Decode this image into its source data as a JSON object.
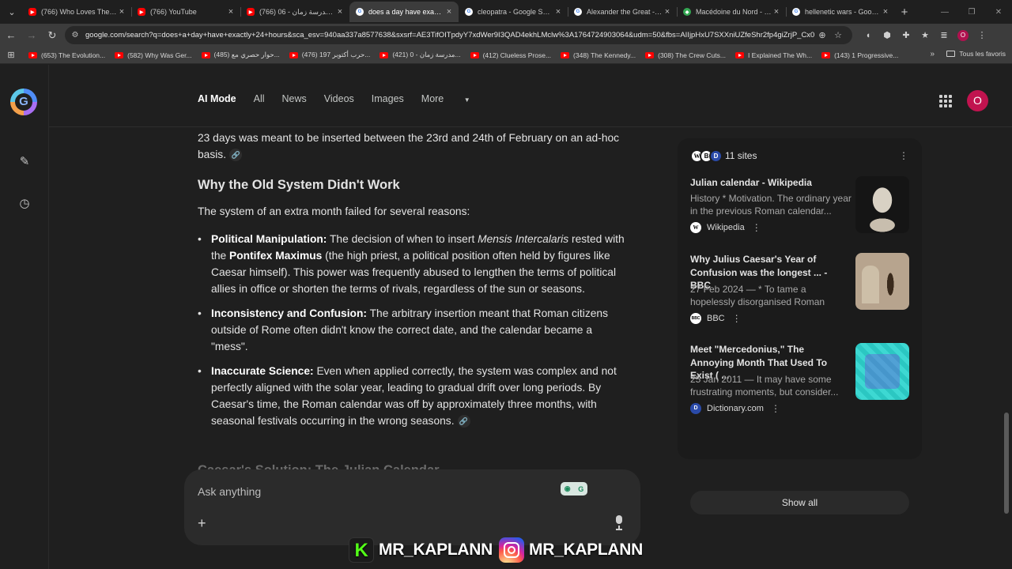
{
  "browser": {
    "tabs": [
      {
        "title": "(766) Who Loves The Sun",
        "favicon": "youtube-icon"
      },
      {
        "title": "(766) YouTube",
        "favicon": "youtube-icon"
      },
      {
        "title": "(766) مدرسة زمان - 06 (da",
        "favicon": "youtube-icon"
      },
      {
        "title": "does a day have exactly 2",
        "favicon": "google-icon",
        "active": true
      },
      {
        "title": "cleopatra - Google Search",
        "favicon": "google-icon"
      },
      {
        "title": "Alexander the Great - Go",
        "favicon": "google-icon"
      },
      {
        "title": "Macédoine du Nord - Go",
        "favicon": "maps-icon"
      },
      {
        "title": "hellenetic wars - Google S",
        "favicon": "google-icon"
      }
    ],
    "url": "google.com/search?q=does+a+day+have+exactly+24+hours&sca_esv=940aa337a8577638&sxsrf=AE3TifOITpdyY7xdWer9I3QAD4ekhLMclw%3A1764724903064&udm=50&fbs=AIIjpHxU7SXXniUZfeShr2fp4giZrjP_Cx0LI1Ytb...",
    "profile_letter": "O",
    "bookmarks": [
      "(653) The Evolution...",
      "(582) Why Was Ger...",
      "(485) حوار حصري مع...",
      "(476) حرب أكتوبر 197...",
      "(421) مدرسة زمان - 0...",
      "(412) Clueless Prose...",
      "(348) The Kennedy...",
      "(308) The Crew Cuts...",
      "I Explained The Wh...",
      "(143) 1 Progressive..."
    ],
    "bookmarks_folder": "Tous les favoris"
  },
  "nav": {
    "items": [
      "AI Mode",
      "All",
      "News",
      "Videos",
      "Images",
      "More"
    ],
    "avatar_letter": "O"
  },
  "article": {
    "intro": "23 days was meant to be inserted between the 23rd and 24th of February on an ad-hoc basis.",
    "heading": "Why the Old System Didn't Work",
    "lead": "The system of an extra month failed for several reasons:",
    "bullets": [
      {
        "label": "Political Manipulation:",
        "t1": " The decision of when to insert ",
        "em": "Mensis Intercalaris",
        "t2": " rested with the ",
        "strong": "Pontifex Maximus",
        "t3": " (the high priest, a political position often held by figures like Caesar himself). This power was frequently abused to lengthen the terms of political allies in office or shorten the terms of rivals, regardless of the sun or seasons."
      },
      {
        "label": "Inconsistency and Confusion:",
        "text": " The arbitrary insertion meant that Roman citizens outside of Rome often didn't know the correct date, and the calendar became a \"mess\"."
      },
      {
        "label": "Inaccurate Science:",
        "text": " Even when applied correctly, the system was complex and not perfectly aligned with the solar year, leading to gradual drift over long periods. By Caesar's time, the Roman calendar was off by approximately three months, with seasonal festivals occurring in the wrong seasons."
      }
    ],
    "next_heading": "Caesar's Solution: The Julian Calendar"
  },
  "sources": {
    "count_label": "11 sites",
    "cards": [
      {
        "title": "Julian calendar - Wikipedia",
        "snippet": "History * Motivation. The ordinary year in the previous Roman calendar...",
        "source": "Wikipedia",
        "source_icon": "W"
      },
      {
        "title": "Why Julius Caesar's Year of Confusion was the longest ... - BBC",
        "snippet": "27 Feb 2024 — * To tame a hopelessly disorganised Roman calendar, Julius...",
        "source": "BBC",
        "source_icon": "BBC"
      },
      {
        "title": "Meet \"Mercedonius,\" The Annoying Month That Used To Exist ( ...",
        "snippet": "25 Jan 2011 — It may have some frustrating moments, but consider...",
        "source": "Dictionary.com",
        "source_icon": "D"
      }
    ],
    "show_all": "Show all"
  },
  "ask": {
    "placeholder": "Ask anything"
  },
  "watermark": {
    "kick_handle": "MR_KAPLANN",
    "instagram_handle": "MR_KAPLANN"
  },
  "colors": {
    "background": "#1f1f1f",
    "avatar": "#c1134f",
    "kick_green": "#53fc18"
  }
}
